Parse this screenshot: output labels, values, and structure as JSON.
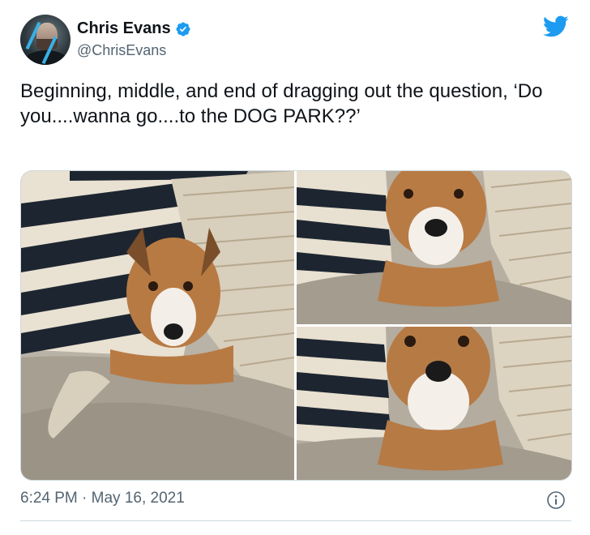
{
  "author": {
    "name": "Chris Evans",
    "handle": "@ChrisEvans",
    "verified_icon": "verified-badge-icon",
    "avatar_icon": "avatar"
  },
  "brand": {
    "icon": "twitter-bird-icon",
    "color": "#1d9bf0"
  },
  "tweet": {
    "text": "Beginning, middle, and end of dragging out the question, ‘Do you....wanna go....to the DOG PARK??’"
  },
  "media": {
    "count": 3,
    "photos": [
      {
        "subject": "dog peeking between pillows"
      },
      {
        "subject": "dog closer up between pillows"
      },
      {
        "subject": "dog close up looking up"
      }
    ]
  },
  "meta": {
    "time": "6:24 PM",
    "separator": "·",
    "date": "May 16, 2021",
    "info_icon": "info-icon"
  },
  "colors": {
    "text": "#0f1419",
    "secondary": "#536471",
    "border": "#cfd9de"
  }
}
